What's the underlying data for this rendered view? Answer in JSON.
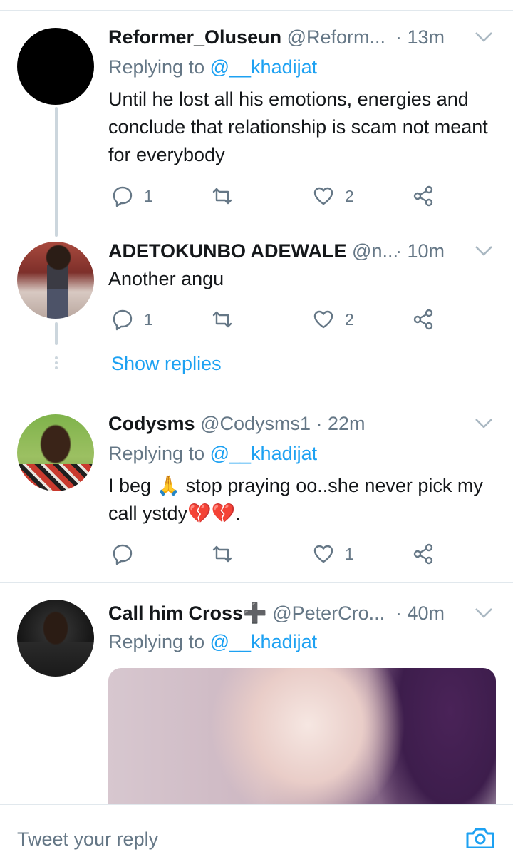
{
  "tweets": [
    {
      "name": "Reformer_Oluseun",
      "handle": "@Reform...",
      "time": "· 13m",
      "replying_prefix": "Replying to",
      "replying_to": "@__khadijat",
      "text": "Until he lost all his emotions, energies and conclude that  relationship is scam not meant for everybody",
      "reply_count": "1",
      "retweet_count": "",
      "like_count": "2",
      "avatar": "black-circle-avatar"
    },
    {
      "name": "ADETOKUNBO ADEWALE",
      "handle": "@n...",
      "time": "· 10m",
      "text": "Another angu",
      "reply_count": "1",
      "retweet_count": "",
      "like_count": "2",
      "show_replies": "Show replies",
      "avatar": "photo-avatar"
    },
    {
      "name": "Codysms",
      "handle": "@Codysms1",
      "time": "· 22m",
      "replying_prefix": "Replying to",
      "replying_to": "@__khadijat",
      "text": "I beg 🙏 stop praying oo..she never pick my call ystdy💔💔.",
      "reply_count": "",
      "retweet_count": "",
      "like_count": "1",
      "avatar": "photo-avatar"
    },
    {
      "name": "Call him Cross➕",
      "handle": "@PeterCro...",
      "time": "· 40m",
      "replying_prefix": "Replying to",
      "replying_to": "@__khadijat",
      "avatar": "photo-avatar"
    }
  ],
  "composer": {
    "placeholder": "Tweet your reply",
    "camera_icon": "camera-icon"
  },
  "colors": {
    "accent": "#1da1f2",
    "secondary_text": "#657786",
    "primary_text": "#14171a",
    "divider": "#e1e8ed"
  }
}
